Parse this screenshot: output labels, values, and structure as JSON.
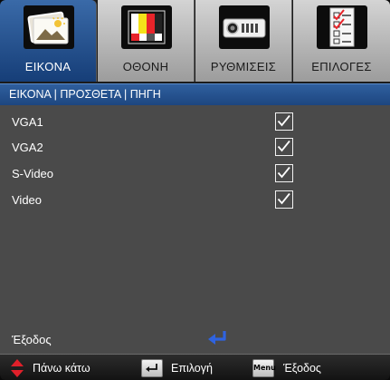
{
  "tabs": [
    {
      "label": "ΕΙΚΟΝΑ",
      "icon": "picture-icon",
      "active": true
    },
    {
      "label": "ΟΘΟΝΗ",
      "icon": "screen-color-bars-icon",
      "active": false
    },
    {
      "label": "ΡΥΘΜΙΣΕΙΣ",
      "icon": "projector-icon",
      "active": false
    },
    {
      "label": "ΕΠΙΛΟΓΕΣ",
      "icon": "checklist-icon",
      "active": false
    }
  ],
  "header": {
    "breadcrumb": "ΕΙΚΟΝΑ | ΠΡΟΣΘΕΤΑ | ΠΗΓΗ"
  },
  "sources": [
    {
      "label": "VGA1",
      "checked": true
    },
    {
      "label": "VGA2",
      "checked": true
    },
    {
      "label": "S-Video",
      "checked": true
    },
    {
      "label": "Video",
      "checked": true
    }
  ],
  "exit": {
    "label": "Έξοδος",
    "icon": "enter-arrow-icon"
  },
  "footer": {
    "updown": "Πάνω κάτω",
    "select": "Επιλογή",
    "exit": "Έξοδος",
    "menu_key": "Menu"
  },
  "colors": {
    "active_tab": "#2a5a9a",
    "header": "#2a5590",
    "body": "#4a4a4a",
    "updown_arrows": "#e0202a",
    "enter_arrow": "#2f63e0"
  }
}
